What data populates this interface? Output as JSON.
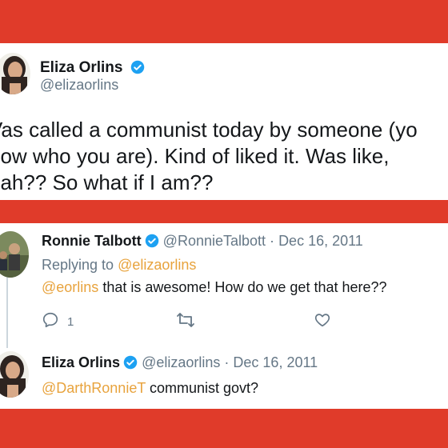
{
  "tweet1": {
    "author_name": "Eliza Orlins",
    "author_handle": "@elizaorlins",
    "text": "Was called a communist today by someone (you know who you are). Kind of liked it. Was like, yeah?? So what if I am??",
    "text_lines_visible": "Vas called a communist today by someone (yo\nnow who you are). Kind of liked it. Was like,\neah?? So what if I am??"
  },
  "tweet2": {
    "author_name": "Ronnie Talbott",
    "author_handle": "@RonnieTalbott",
    "separator": "·",
    "date": "Dec 16, 2011",
    "replying_prefix": "Replying to",
    "replying_to": "@elizaorlins",
    "mention": "@eorlins",
    "text": "that is awesome! How do we get that here??",
    "reply_count": "1"
  },
  "tweet3": {
    "author_name": "Eliza Orlins",
    "author_handle": "@elizaorlins",
    "separator": "·",
    "date": "Dec 16, 2011",
    "mention": "@DarthRonnieT",
    "text": "communist govt?"
  },
  "colors": {
    "background": "#e03b2a",
    "card": "#ffffff",
    "verified": "#1da1f2",
    "mention": "#e8a33d",
    "secondary_text": "#657786"
  },
  "icons": [
    "verified-badge-icon",
    "reply-icon",
    "retweet-icon",
    "like-icon"
  ]
}
